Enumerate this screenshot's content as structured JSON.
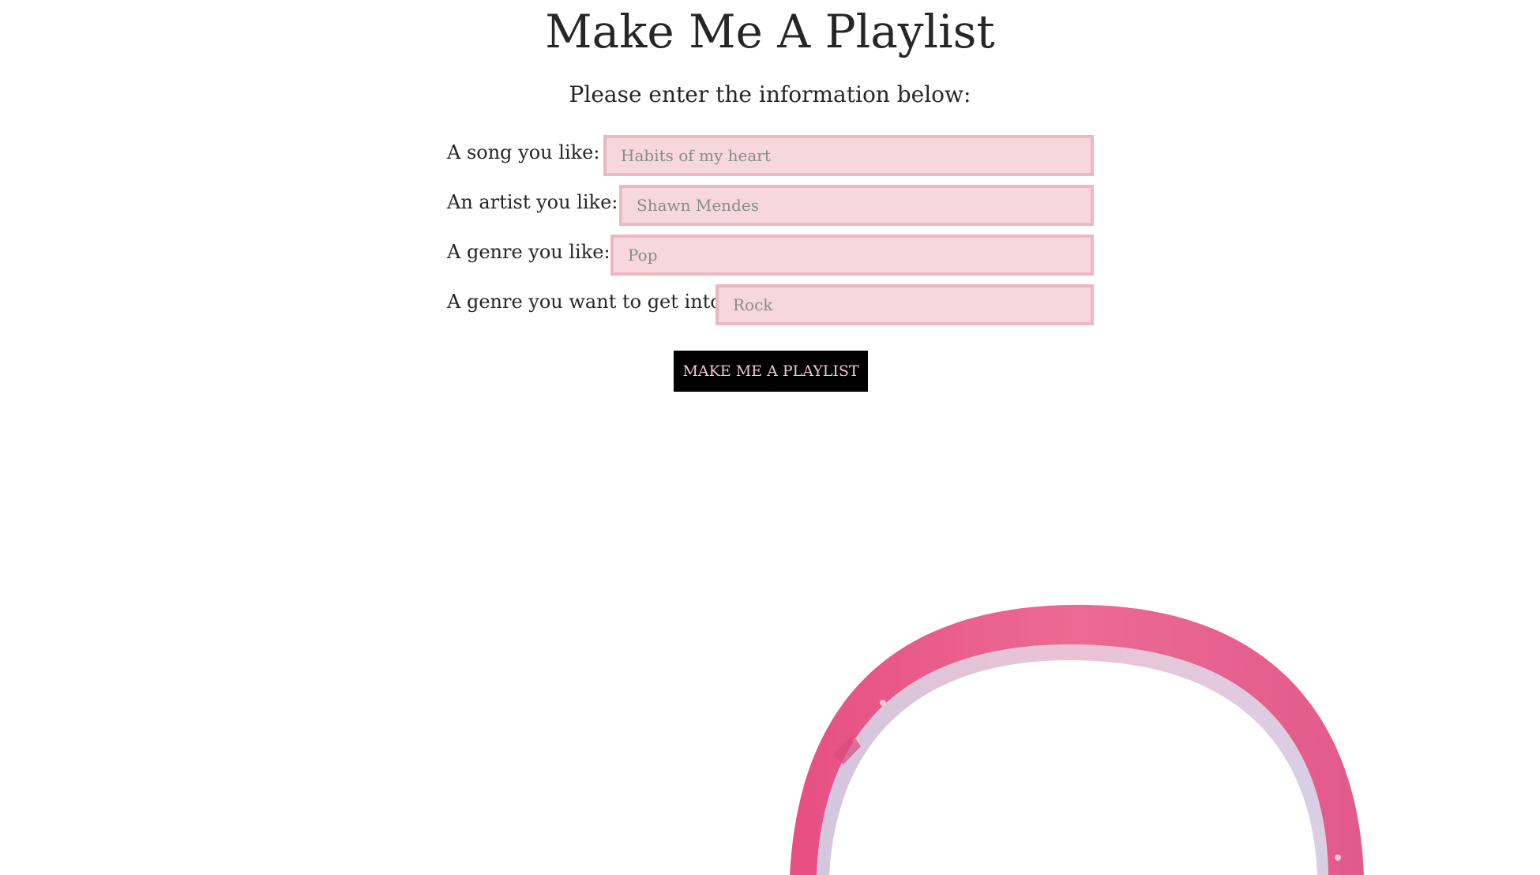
{
  "page": {
    "title": "Make Me A Playlist",
    "subtitle": "Please enter the information below:"
  },
  "form": {
    "fields": [
      {
        "label": "A song you like:",
        "placeholder": "Habits of my heart",
        "value": ""
      },
      {
        "label": "An artist you like:",
        "placeholder": "Shawn Mendes",
        "value": ""
      },
      {
        "label": "A genre you like:",
        "placeholder": "Pop",
        "value": ""
      },
      {
        "label": "A genre you want to get into:",
        "placeholder": "Rock",
        "value": ""
      }
    ],
    "submit_label": "MAKE ME A PLAYLIST"
  },
  "colors": {
    "input_background": "#f5d7dd",
    "input_border": "#edb6c3",
    "button_background": "#000000",
    "button_text": "#f2c7d0",
    "headphones_pink": "#e85a8a"
  },
  "decoration": {
    "image": "headphones-image"
  }
}
